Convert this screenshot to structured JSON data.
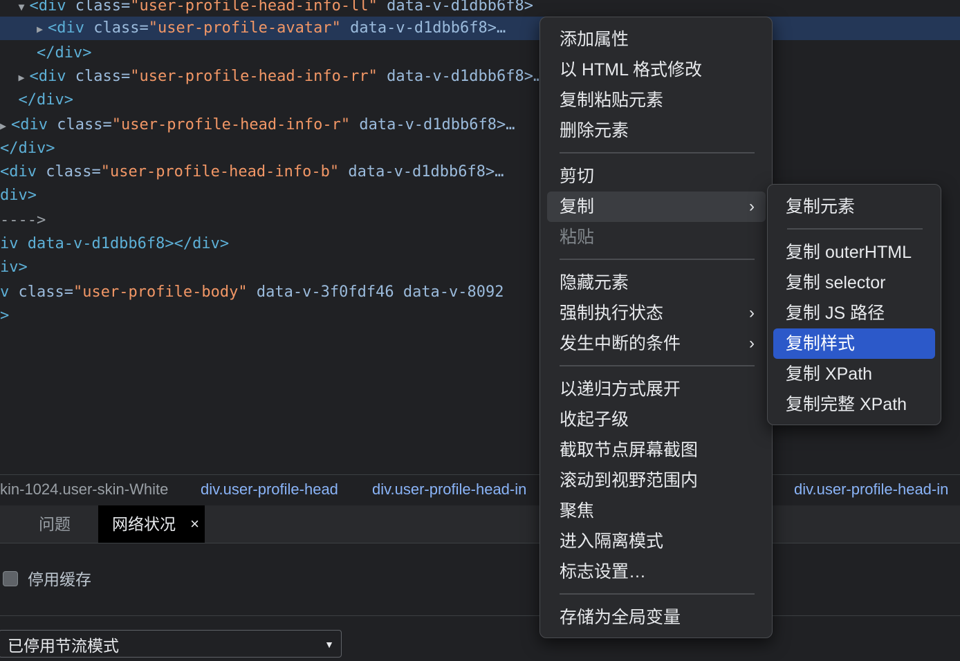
{
  "dom_tree": {
    "lines": [
      {
        "pre": "  ",
        "tri": "▼",
        "tag_open": "<div ",
        "attr_name": "class=",
        "attr_value": "\"user-profile-head-info-ll\"",
        "rest": " data-v-d1dbb6f8>"
      },
      {
        "pre": "    ",
        "tri": "▶",
        "tag_open": "<div ",
        "attr_name": "class=",
        "attr_value": "\"user-profile-avatar\"",
        "rest": " data-v-d1dbb6f8>…"
      },
      {
        "text": "    </div>"
      },
      {
        "pre": "  ",
        "tri": "▶",
        "tag_open": "<div ",
        "attr_name": "class=",
        "attr_value": "\"user-profile-head-info-rr\"",
        "rest": " data-v-d1dbb6f8>…"
      },
      {
        "text": "  </div>"
      },
      {
        "pre": "",
        "tri": "▶",
        "tag_open": "<div ",
        "attr_name": "class=",
        "attr_value": "\"user-profile-head-info-r\"",
        "rest": " data-v-d1dbb6f8>…"
      },
      {
        "text": "</div>"
      },
      {
        "pre": "",
        "tri": "",
        "tag_open": "<div ",
        "attr_name": "class=",
        "attr_value": "\"user-profile-head-info-b\"",
        "rest": " data-v-d1dbb6f8>…"
      },
      {
        "text": "div>"
      },
      {
        "text": "---->"
      },
      {
        "text": "iv data-v-d1dbb6f8></div>"
      },
      {
        "text": "iv>"
      },
      {
        "pre": "",
        "tri": "",
        "tag_open": "v ",
        "attr_name": "class=",
        "attr_value": "\"user-profile-body\"",
        "rest": " data-v-3f0fdf46 data-v-8092"
      },
      {
        "text": ">"
      }
    ]
  },
  "breadcrumb": [
    "kin-1024.user-skin-White",
    "div.user-profile-head",
    "div.user-profile-head-in",
    "div.user-profile-head-in"
  ],
  "drawer": {
    "tabs": [
      "问题",
      "网络状况"
    ],
    "close_glyph": "×"
  },
  "network": {
    "disable_cache_label": "停用缓存",
    "disable_cache_checked": false,
    "throttling_value": "已停用节流模式"
  },
  "context_menu": {
    "items": [
      {
        "label": "添加属性"
      },
      {
        "label": "以 HTML 格式修改"
      },
      {
        "label": "复制粘贴元素"
      },
      {
        "label": "删除元素"
      },
      {
        "label": "剪切"
      },
      {
        "label": "复制",
        "submenu": true,
        "highlighted": true
      },
      {
        "label": "粘贴",
        "disabled": true
      },
      {
        "label": "隐藏元素"
      },
      {
        "label": "强制执行状态",
        "submenu": true
      },
      {
        "label": "发生中断的条件",
        "submenu": true
      },
      {
        "label": "以递归方式展开"
      },
      {
        "label": "收起子级"
      },
      {
        "label": "截取节点屏幕截图"
      },
      {
        "label": "滚动到视野范围内"
      },
      {
        "label": "聚焦"
      },
      {
        "label": "进入隔离模式"
      },
      {
        "label": "标志设置…"
      },
      {
        "label": "存储为全局变量"
      }
    ],
    "arrow_icon": "chevron-right-icon"
  },
  "copy_submenu": {
    "items": [
      {
        "label": "复制元素"
      },
      {
        "label": "复制 outerHTML"
      },
      {
        "label": "复制 selector"
      },
      {
        "label": "复制 JS 路径"
      },
      {
        "label": "复制样式",
        "active": true
      },
      {
        "label": "复制 XPath"
      },
      {
        "label": "复制完整 XPath"
      }
    ]
  },
  "colors": {
    "selected_row": "#243757",
    "active_item": "#2c59c9",
    "attr_value": "#f29766",
    "tag": "#5db0d7"
  }
}
